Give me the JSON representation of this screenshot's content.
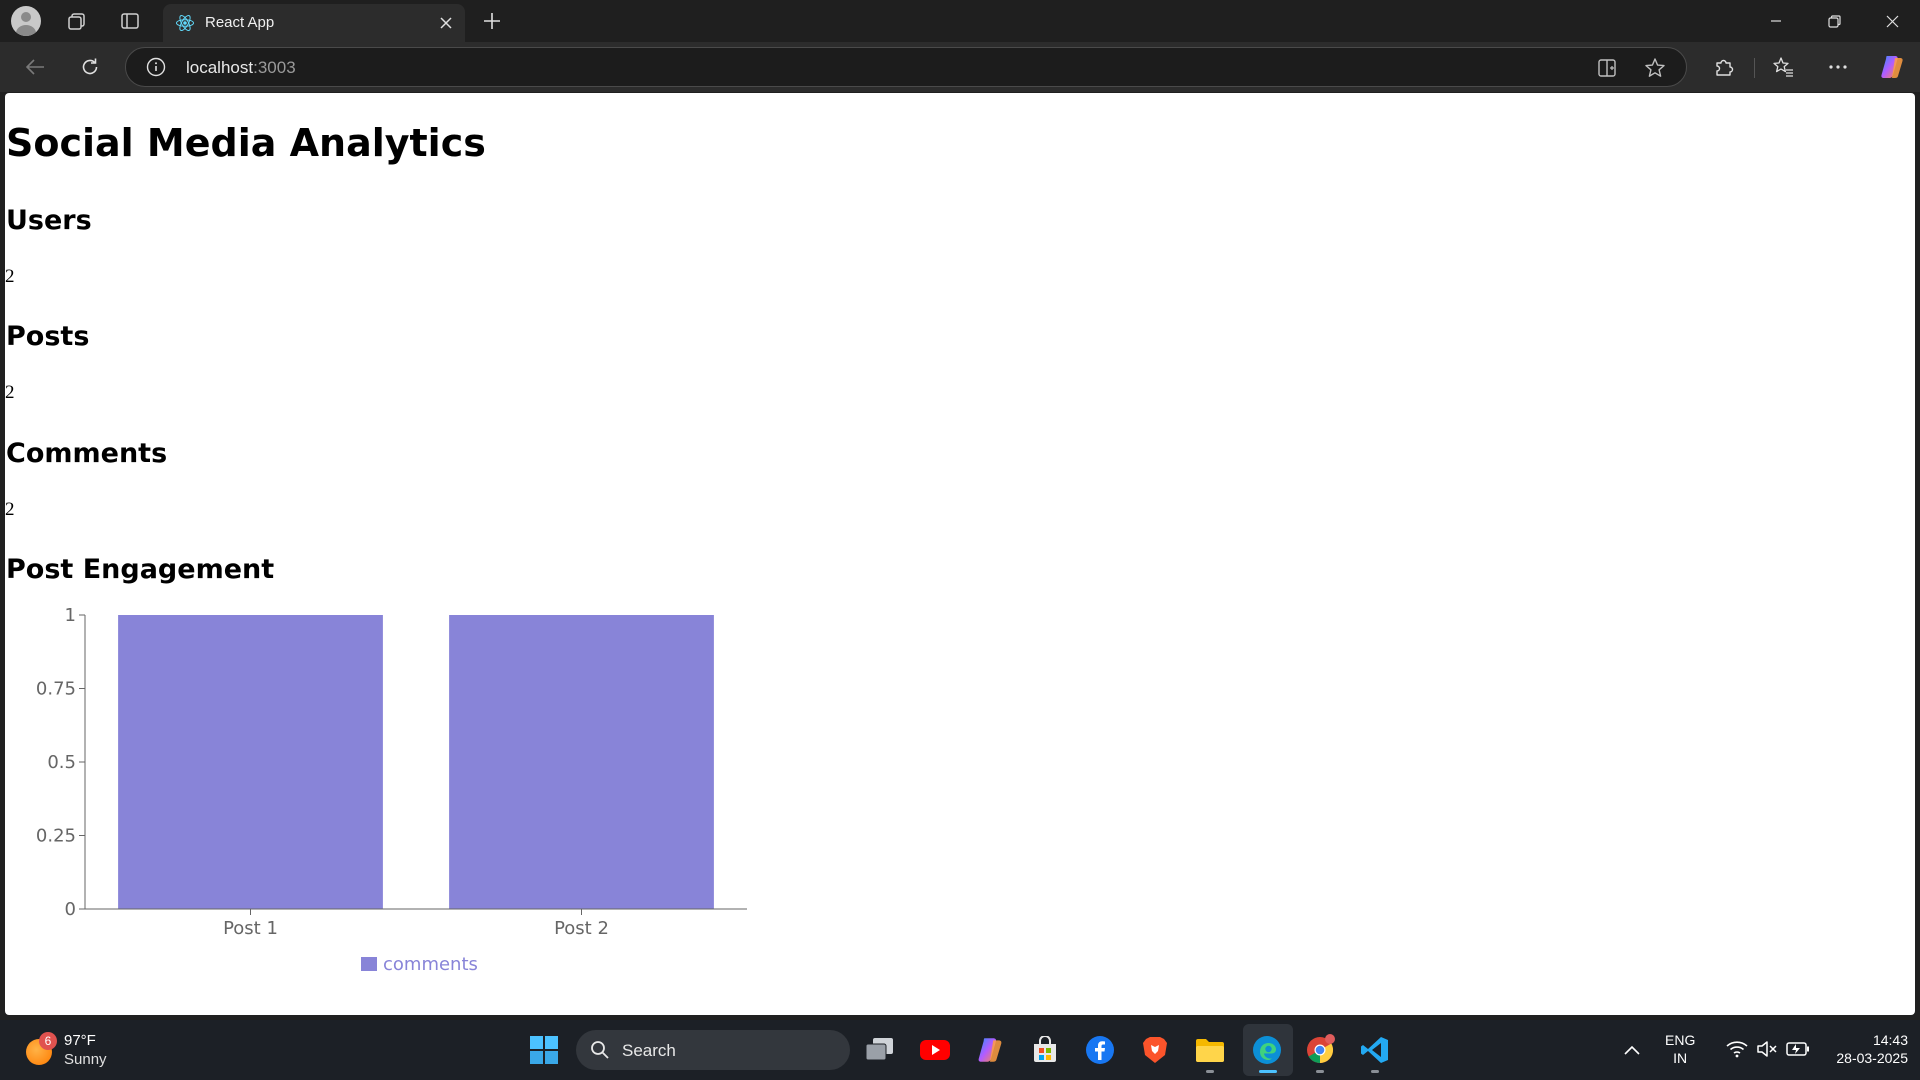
{
  "browser": {
    "tab_title": "React App",
    "url_host": "localhost",
    "url_port": ":3003"
  },
  "page": {
    "title": "Social Media Analytics",
    "sections": [
      {
        "heading": "Users",
        "value": "2"
      },
      {
        "heading": "Posts",
        "value": "2"
      },
      {
        "heading": "Comments",
        "value": "2"
      }
    ],
    "chart_heading": "Post Engagement"
  },
  "chart_data": {
    "type": "bar",
    "categories": [
      "Post 1",
      "Post 2"
    ],
    "series": [
      {
        "name": "comments",
        "values": [
          1,
          1
        ],
        "color": "#8884d8"
      }
    ],
    "xlabel": "",
    "ylabel": "",
    "ylim": [
      0,
      1
    ],
    "yticks": [
      0,
      0.25,
      0.5,
      0.75,
      1
    ],
    "ytick_labels": [
      "0",
      "0.25",
      "0.5",
      "0.75",
      "1"
    ],
    "grid": false,
    "legend": "bottom"
  },
  "taskbar": {
    "weather_badge": "6",
    "weather_temp": "97°F",
    "weather_cond": "Sunny",
    "search_label": "Search",
    "lang_line1": "ENG",
    "lang_line2": "IN",
    "time": "14:43",
    "date": "28-03-2025"
  },
  "colors": {
    "accent": "#8884d8",
    "taskbar_active": "#4cc2ff"
  }
}
